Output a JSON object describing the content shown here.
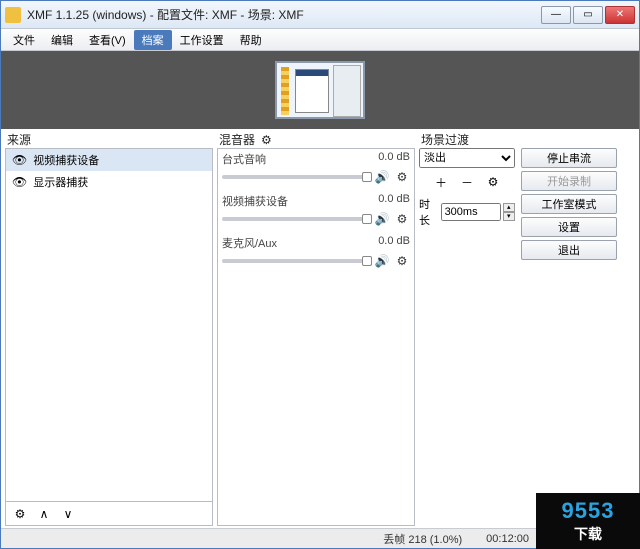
{
  "titlebar": {
    "title": "XMF 1.1.25 (windows) - 配置文件: XMF - 场景: XMF"
  },
  "menu": {
    "file": "文件",
    "edit": "编辑",
    "view": "查看(V)",
    "profile": "档案",
    "work": "工作设置",
    "help": "帮助"
  },
  "panels": {
    "sources": "来源",
    "mixer": "混音器",
    "scene": "场景过渡"
  },
  "sources": {
    "items": [
      {
        "label": "视频捕获设备"
      },
      {
        "label": "显示器捕获"
      }
    ]
  },
  "mixer": {
    "channels": [
      {
        "name": "台式音响",
        "db": "0.0 dB"
      },
      {
        "name": "视频捕获设备",
        "db": "0.0 dB"
      },
      {
        "name": "麦克风/Aux",
        "db": "0.0 dB"
      }
    ]
  },
  "scene": {
    "select": "淡出",
    "duration_label": "时长",
    "duration_value": "300ms"
  },
  "buttons": {
    "stop_stream": "停止串流",
    "start_record": "开始录制",
    "studio": "工作室模式",
    "settings": "设置",
    "exit": "退出"
  },
  "status": {
    "dropped": "丢帧 218 (1.0%)",
    "time": "00:12:00"
  },
  "watermark": {
    "num": "9553",
    "zh": "下载"
  }
}
